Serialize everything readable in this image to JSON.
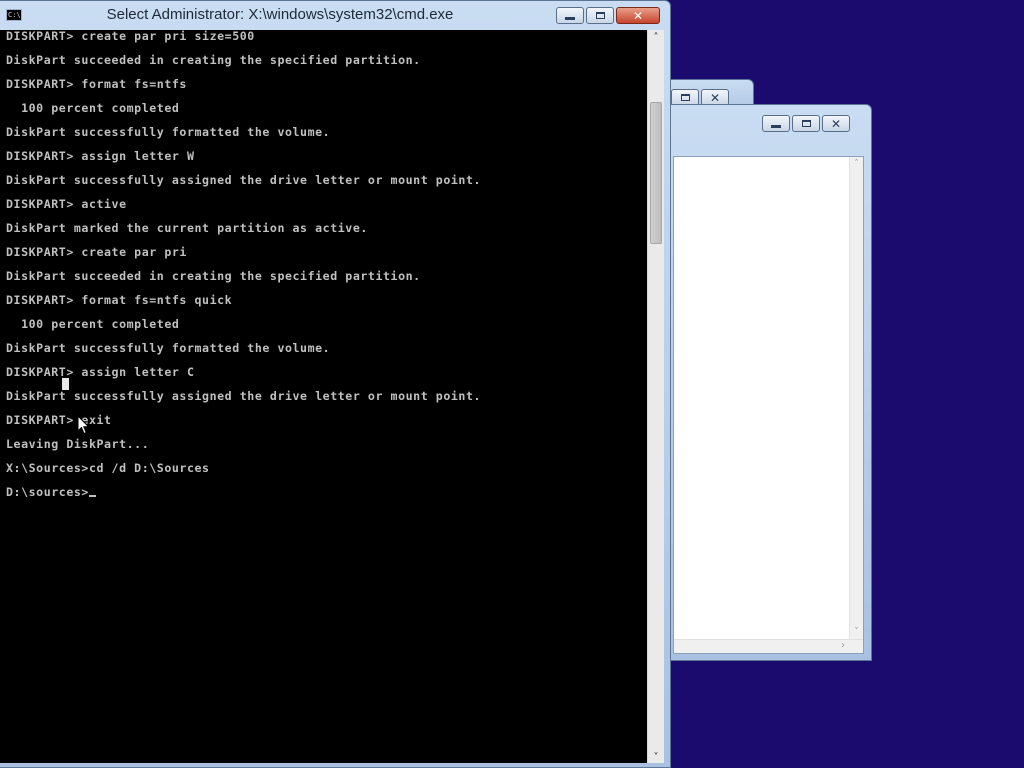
{
  "desktop": {
    "background_color": "#1c0b6e"
  },
  "background_windows": {
    "back_window": {
      "buttons": [
        {
          "name": "restore-button",
          "icon": "restore-icon"
        },
        {
          "name": "close-button",
          "icon": "close-icon",
          "glyph": "✕"
        }
      ]
    },
    "front_window": {
      "buttons": [
        {
          "name": "minimize-button",
          "icon": "minimize-icon"
        },
        {
          "name": "maximize-button",
          "icon": "maximize-icon"
        },
        {
          "name": "close-button",
          "icon": "close-icon",
          "glyph": "✕"
        }
      ],
      "scroll_up_glyph": "˄",
      "scroll_down_glyph": "˅",
      "scroll_right_glyph": "›"
    }
  },
  "cmd_window": {
    "title": "Select Administrator: X:\\windows\\system32\\cmd.exe",
    "icon_text": "C:\\",
    "buttons": {
      "minimize_icon": "minimize-icon",
      "restore_icon": "restore-icon",
      "close_glyph": "✕"
    },
    "scroll_up_glyph": "˄",
    "scroll_down_glyph": "˅",
    "console_lines": [
      "DISKPART> create par pri size=500",
      "DiskPart succeeded in creating the specified partition.",
      "DISKPART> format fs=ntfs",
      "  100 percent completed",
      "DiskPart successfully formatted the volume.",
      "DISKPART> assign letter W",
      "DiskPart successfully assigned the drive letter or mount point.",
      "DISKPART> active",
      "DiskPart marked the current partition as active.",
      "DISKPART> create par pri",
      "DiskPart succeeded in creating the specified partition.",
      "DISKPART> format fs=ntfs quick",
      "  100 percent completed",
      "DiskPart successfully formatted the volume.",
      "DISKPART> assign letter C",
      "DiskPart successfully assigned the drive letter or mount point.",
      "DISKPART> exit",
      "Leaving DiskPart...",
      "X:\\Sources>cd /d D:\\Sources",
      "D:\\sources>"
    ],
    "colors": {
      "console_background": "#000000",
      "console_text": "#c0c0c0"
    }
  }
}
